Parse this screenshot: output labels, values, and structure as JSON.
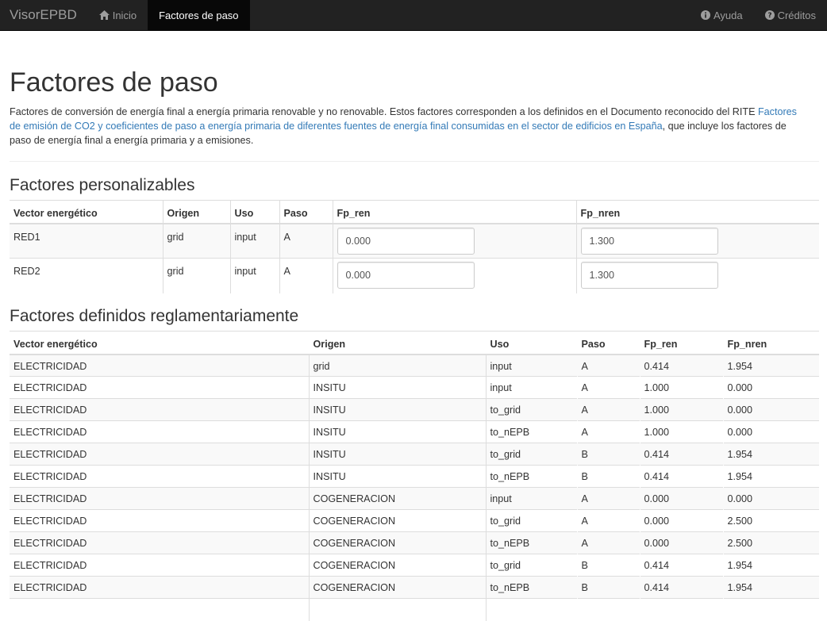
{
  "navbar": {
    "brand": "VisorEPBD",
    "home_label": "Inicio",
    "factors_label": "Factores de paso",
    "help_label": "Ayuda",
    "credits_label": "Créditos"
  },
  "page": {
    "title": "Factores de paso",
    "intro_text": "Factores de conversión de energía final a energía primaria renovable y no renovable. Estos factores corresponden a los definidos en el Documento reconocido del RITE ",
    "intro_link": "Factores de emisión de CO2 y coeficientes de paso a energía primaria de diferentes fuentes de energía final consumidas en el sector de edificios en España",
    "intro_tail": ", que incluye los factores de paso de energía final a energía primaria y a emisiones."
  },
  "custom": {
    "heading": "Factores personalizables",
    "headers": [
      "Vector energético",
      "Origen",
      "Uso",
      "Paso",
      "Fp_ren",
      "Fp_nren"
    ],
    "rows": [
      {
        "vector": "RED1",
        "origen": "grid",
        "uso": "input",
        "paso": "A",
        "fp_ren": "0.000",
        "fp_nren": "1.300"
      },
      {
        "vector": "RED2",
        "origen": "grid",
        "uso": "input",
        "paso": "A",
        "fp_ren": "0.000",
        "fp_nren": "1.300"
      }
    ]
  },
  "regulated": {
    "heading": "Factores definidos reglamentariamente",
    "headers": [
      "Vector energético",
      "Origen",
      "Uso",
      "Paso",
      "Fp_ren",
      "Fp_nren"
    ],
    "rows": [
      [
        "ELECTRICIDAD",
        "grid",
        "input",
        "A",
        "0.414",
        "1.954"
      ],
      [
        "ELECTRICIDAD",
        "INSITU",
        "input",
        "A",
        "1.000",
        "0.000"
      ],
      [
        "ELECTRICIDAD",
        "INSITU",
        "to_grid",
        "A",
        "1.000",
        "0.000"
      ],
      [
        "ELECTRICIDAD",
        "INSITU",
        "to_nEPB",
        "A",
        "1.000",
        "0.000"
      ],
      [
        "ELECTRICIDAD",
        "INSITU",
        "to_grid",
        "B",
        "0.414",
        "1.954"
      ],
      [
        "ELECTRICIDAD",
        "INSITU",
        "to_nEPB",
        "B",
        "0.414",
        "1.954"
      ],
      [
        "ELECTRICIDAD",
        "COGENERACION",
        "input",
        "A",
        "0.000",
        "0.000"
      ],
      [
        "ELECTRICIDAD",
        "COGENERACION",
        "to_grid",
        "A",
        "0.000",
        "2.500"
      ],
      [
        "ELECTRICIDAD",
        "COGENERACION",
        "to_nEPB",
        "A",
        "0.000",
        "2.500"
      ],
      [
        "ELECTRICIDAD",
        "COGENERACION",
        "to_grid",
        "B",
        "0.414",
        "1.954"
      ],
      [
        "ELECTRICIDAD",
        "COGENERACION",
        "to_nEPB",
        "B",
        "0.414",
        "1.954"
      ],
      [
        "",
        "",
        "",
        "",
        "",
        ""
      ]
    ]
  }
}
